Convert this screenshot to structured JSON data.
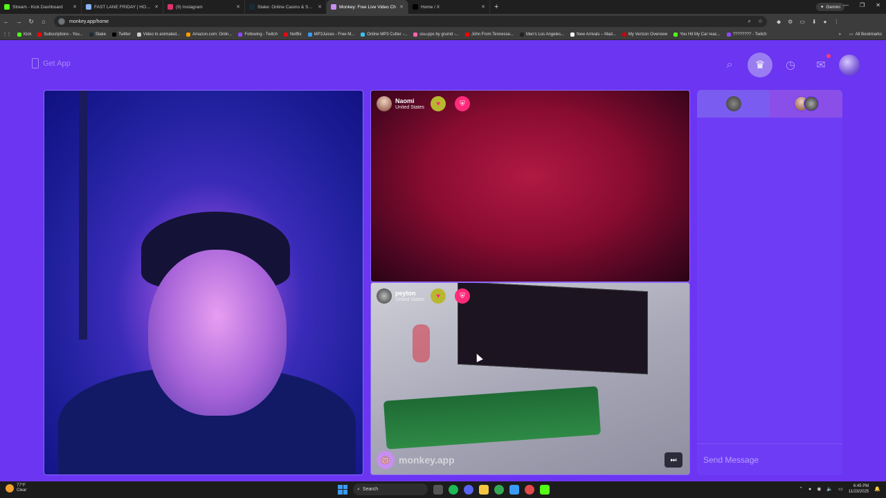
{
  "browser": {
    "tabs": [
      {
        "title": "Stream - Kick Dashboard",
        "favicon_color": "#53fc18",
        "active": false
      },
      {
        "title": "FAST LANE FRIDAY | HOMESTE",
        "favicon_color": "#8ab4f8",
        "active": false
      },
      {
        "title": "(9) Instagram",
        "favicon_color": "#e1306c",
        "active": false
      },
      {
        "title": "Stake: Online Casino & Sports",
        "favicon_color": "#1a2c38",
        "active": false
      },
      {
        "title": "Monkey: Free Live Video Ch",
        "favicon_color": "#c88ef0",
        "active": true
      },
      {
        "title": "Home / X",
        "favicon_color": "#000000",
        "active": false
      }
    ],
    "gemini_label": "Gemini",
    "url": "monkey.app/home",
    "bookmarks": [
      {
        "label": "Kick",
        "color": "#53fc18"
      },
      {
        "label": "Subscriptions - You...",
        "color": "#ff0000"
      },
      {
        "label": "Stake",
        "color": "#1a2c38"
      },
      {
        "label": "Twitter",
        "color": "#000000"
      },
      {
        "label": "Video to animated...",
        "color": "#cccccc"
      },
      {
        "label": "Amazon.com: Onlin...",
        "color": "#ff9900"
      },
      {
        "label": "Following - Twitch",
        "color": "#9146ff"
      },
      {
        "label": "Netflix",
        "color": "#e50914"
      },
      {
        "label": "MP3Juices - Free M...",
        "color": "#3a9bf5"
      },
      {
        "label": "Online MP3 Cutter -...",
        "color": "#3ac0f5"
      },
      {
        "label": "osu-pps by grumd -...",
        "color": "#ff66aa"
      },
      {
        "label": "John From Tennesse...",
        "color": "#ff0000"
      },
      {
        "label": "Men's Los Angeles...",
        "color": "#222222"
      },
      {
        "label": "New Arrivals – Mad...",
        "color": "#ffffff"
      },
      {
        "label": "My Verizon Overview",
        "color": "#cd040b"
      },
      {
        "label": "You Hit My Car reac...",
        "color": "#53fc18"
      },
      {
        "label": "???????? - Twitch",
        "color": "#9146ff"
      }
    ],
    "all_bookmarks_label": "All Bookmarks"
  },
  "app": {
    "get_app_label": "Get App",
    "notification_badge": true,
    "users": [
      {
        "name": "Naomi",
        "country": "United States"
      },
      {
        "name": "peyton",
        "country": "United States"
      }
    ],
    "watermark": "monkey.app",
    "chat": {
      "send_placeholder": "Send Message"
    }
  },
  "taskbar": {
    "weather_temp": "77°F",
    "weather_desc": "Clear",
    "search_label": "Search",
    "time": "6:45 PM",
    "date": "11/23/2025"
  },
  "colors": {
    "app_bg": "#6b35f2",
    "accent_pink": "#ff2a7a",
    "chat_bg": "#6f3cf5"
  }
}
